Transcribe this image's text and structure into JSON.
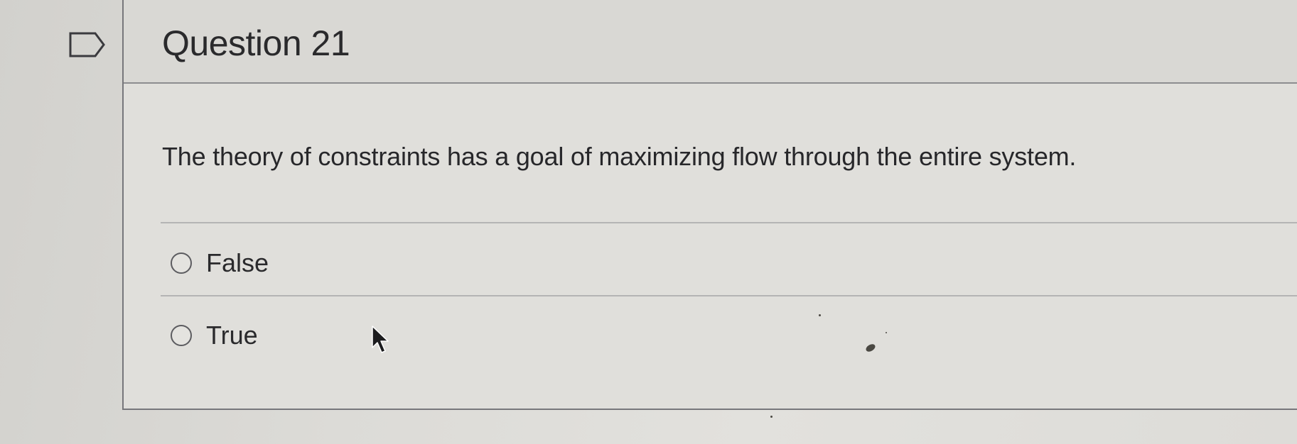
{
  "question": {
    "title": "Question 21",
    "text": "The theory of constraints has a goal of maximizing flow through the entire system.",
    "options": [
      {
        "label": "False",
        "selected": false
      },
      {
        "label": "True",
        "selected": false
      }
    ]
  },
  "icons": {
    "flag": "flag-question-icon",
    "cursor": "mouse-pointer-icon"
  },
  "colors": {
    "border": "#77777b",
    "text": "#2a2a2c",
    "header_bg": "#d9d8d4"
  }
}
